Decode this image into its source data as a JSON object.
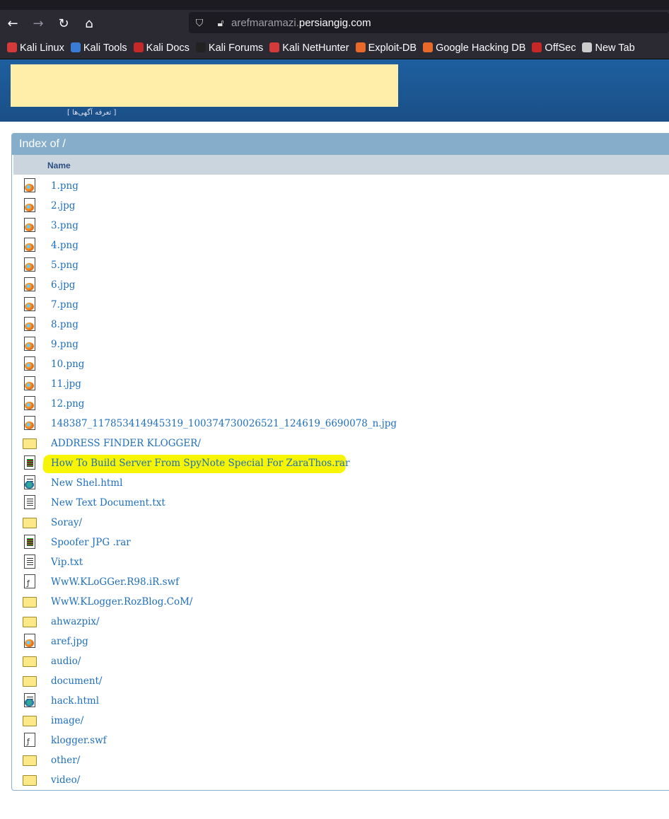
{
  "browser": {
    "url_sub": "arefmaramazi.",
    "url_domain": "persiangig.com",
    "bookmarks": [
      {
        "label": "Kali Linux",
        "color": "#d43a3a"
      },
      {
        "label": "Kali Tools",
        "color": "#3a7bd5"
      },
      {
        "label": "Kali Docs",
        "color": "#c62828"
      },
      {
        "label": "Kali Forums",
        "color": "#222222"
      },
      {
        "label": "Kali NetHunter",
        "color": "#d43a3a"
      },
      {
        "label": "Exploit-DB",
        "color": "#e86a2a"
      },
      {
        "label": "Google Hacking DB",
        "color": "#e86a2a"
      },
      {
        "label": "OffSec",
        "color": "#c62828"
      },
      {
        "label": "New Tab",
        "color": "#cccccc"
      }
    ]
  },
  "banner": {
    "ad_link": "[ تعرفه آگهی‌ها ]"
  },
  "listing": {
    "title": "Index of /",
    "column": "Name",
    "files": [
      {
        "name": "1.png",
        "type": "image"
      },
      {
        "name": "2.jpg",
        "type": "image"
      },
      {
        "name": "3.png",
        "type": "image"
      },
      {
        "name": "4.png",
        "type": "image"
      },
      {
        "name": "5.png",
        "type": "image"
      },
      {
        "name": "6.jpg",
        "type": "image"
      },
      {
        "name": "7.png",
        "type": "image"
      },
      {
        "name": "8.png",
        "type": "image"
      },
      {
        "name": "9.png",
        "type": "image"
      },
      {
        "name": "10.png",
        "type": "image"
      },
      {
        "name": "11.jpg",
        "type": "image"
      },
      {
        "name": "12.png",
        "type": "image"
      },
      {
        "name": "148387_117853414945319_100374730026521_124619_6690078_n.jpg",
        "type": "image"
      },
      {
        "name": "ADDRESS FINDER KLOGGER/",
        "type": "folder"
      },
      {
        "name": "How To Build Server From SpyNote Special For ZaraThos.rar",
        "type": "archive",
        "highlighted": true
      },
      {
        "name": "New Shel.html",
        "type": "web"
      },
      {
        "name": "New Text Document.txt",
        "type": "text"
      },
      {
        "name": "Soray/",
        "type": "folder"
      },
      {
        "name": "Spoofer JPG .rar",
        "type": "archive"
      },
      {
        "name": "Vip.txt",
        "type": "text"
      },
      {
        "name": "WwW.KLoGGer.R98.iR.swf",
        "type": "swf"
      },
      {
        "name": "WwW.KLogger.RozBlog.CoM/",
        "type": "folder"
      },
      {
        "name": "ahwazpix/",
        "type": "folder"
      },
      {
        "name": "aref.jpg",
        "type": "image"
      },
      {
        "name": "audio/",
        "type": "folder"
      },
      {
        "name": "document/",
        "type": "folder"
      },
      {
        "name": "hack.html",
        "type": "web"
      },
      {
        "name": "image/",
        "type": "folder"
      },
      {
        "name": "klogger.swf",
        "type": "swf"
      },
      {
        "name": "other/",
        "type": "folder"
      },
      {
        "name": "video/",
        "type": "folder"
      }
    ]
  }
}
